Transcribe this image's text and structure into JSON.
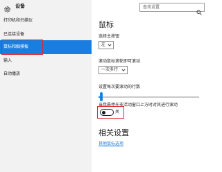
{
  "app": {
    "title": "设备"
  },
  "search": {
    "placeholder": "查找设置"
  },
  "sidebar": {
    "items": [
      {
        "label": "打印机和扫描仪"
      },
      {
        "label": "已连接设备"
      },
      {
        "label": "鼠标和触摸板",
        "selected": true
      },
      {
        "label": "输入"
      },
      {
        "label": "自动播放"
      }
    ]
  },
  "main": {
    "section_title": "鼠标",
    "primary_button": {
      "label": "选择主按钮",
      "value": "左"
    },
    "scroll_mode": {
      "label": "滚动鼠标滚轮即可滚动",
      "value": "一次多行"
    },
    "scroll_lines": {
      "label": "设置每次要滚动的行数",
      "value_fraction": 0.02
    },
    "inactive_scroll": {
      "label": "当我悬停在非活动窗口上方时对其进行滚动",
      "state": "关"
    },
    "related_title": "相关设置",
    "related_link": "其他鼠标选项"
  },
  "colors": {
    "accent": "#1a7de0",
    "highlight_box": "#e0262d",
    "sidebar_bg": "#f2f2f2"
  },
  "icons": {
    "app": "gear-icon",
    "search": "search-icon",
    "dropdown": "chevron-down-icon"
  }
}
